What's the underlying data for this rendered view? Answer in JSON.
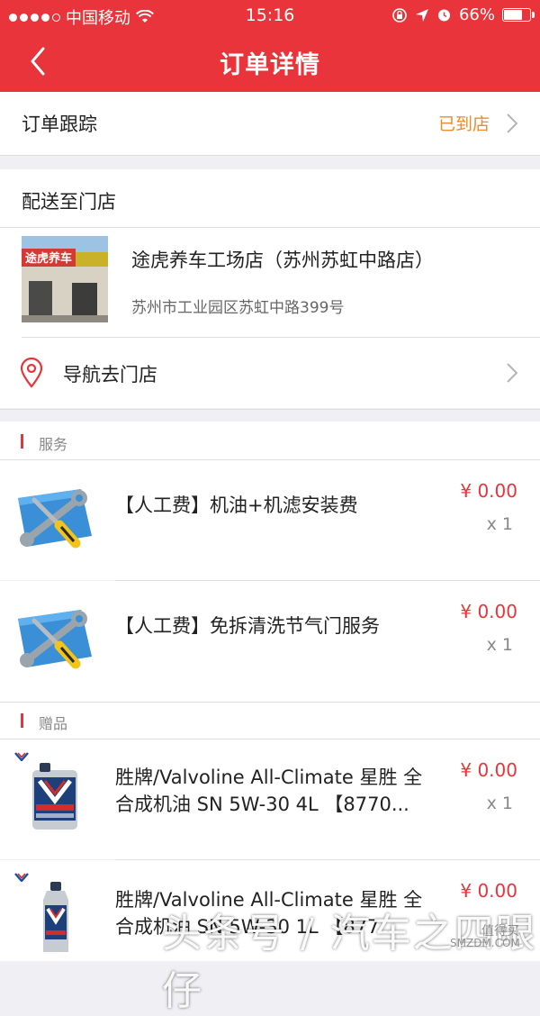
{
  "status_bar": {
    "carrier": "中国移动",
    "time": "15:16",
    "battery": "66%"
  },
  "nav": {
    "title": "订单详情"
  },
  "tracking": {
    "label": "订单跟踪",
    "status": "已到店",
    "status_color": "#f08a2a"
  },
  "delivery": {
    "label": "配送至门店",
    "store_name": "途虎养车工场店（苏州苏虹中路店）",
    "store_address": "苏州市工业园区苏虹中路399号",
    "store_sign_text": "途虎养车",
    "navigate_label": "导航去门店"
  },
  "services": {
    "header": "服务",
    "items": [
      {
        "name": "【人工费】机油+机滤安装费",
        "price": "¥ 0.00",
        "qty": "x 1"
      },
      {
        "name": "【人工费】免拆清洗节气门服务",
        "price": "¥ 0.00",
        "qty": "x 1"
      }
    ]
  },
  "gifts": {
    "header": "赠品",
    "items": [
      {
        "name_line1": "胜牌/Valvoline All-Climate 星胜 全",
        "name_line2": "合成机油 SN 5W-30 4L 【8770...",
        "price": "¥ 0.00",
        "qty": "x 1"
      },
      {
        "name_line1": "胜牌/Valvoline All-Climate 星胜 全",
        "name_line2": "合成机油 SN 5W-30 1L 【877...",
        "price": "¥ 0.00"
      }
    ]
  },
  "watermark": {
    "text": "头条号 / 汽车之四眼仔",
    "site": "SMZDM.COM",
    "site_cn": "值得买"
  },
  "colors": {
    "brand_red": "#e8343a",
    "accent_orange": "#f08a2a"
  }
}
